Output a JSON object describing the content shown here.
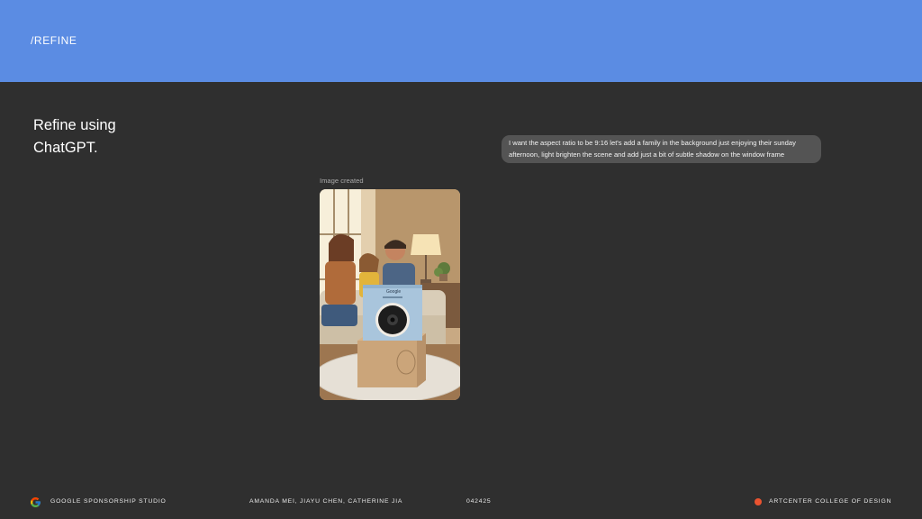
{
  "header": {
    "label": "/REFINE",
    "color": "#5b8ce3"
  },
  "main": {
    "heading_line1": "Refine using",
    "heading_line2": "ChatGPT.",
    "prompt_line1": "I want the aspect ratio to be 9:16 let's add a family in the background just enjoying their sunday",
    "prompt_line2": "afternoon, light brighten the scene and add just a bit of subtle shadow on the window frame",
    "image_caption": "Image created",
    "product_brand": "Google"
  },
  "footer": {
    "left_icon": "google-g-icon",
    "studio": "GOOGLE SPONSORSHIP STUDIO",
    "authors": "AMANDA MEI, JIAYU CHEN, CATHERINE JIA",
    "date": "042425",
    "school": "ARTCENTER COLLEGE OF DESIGN",
    "dot_color": "#ea5330"
  }
}
